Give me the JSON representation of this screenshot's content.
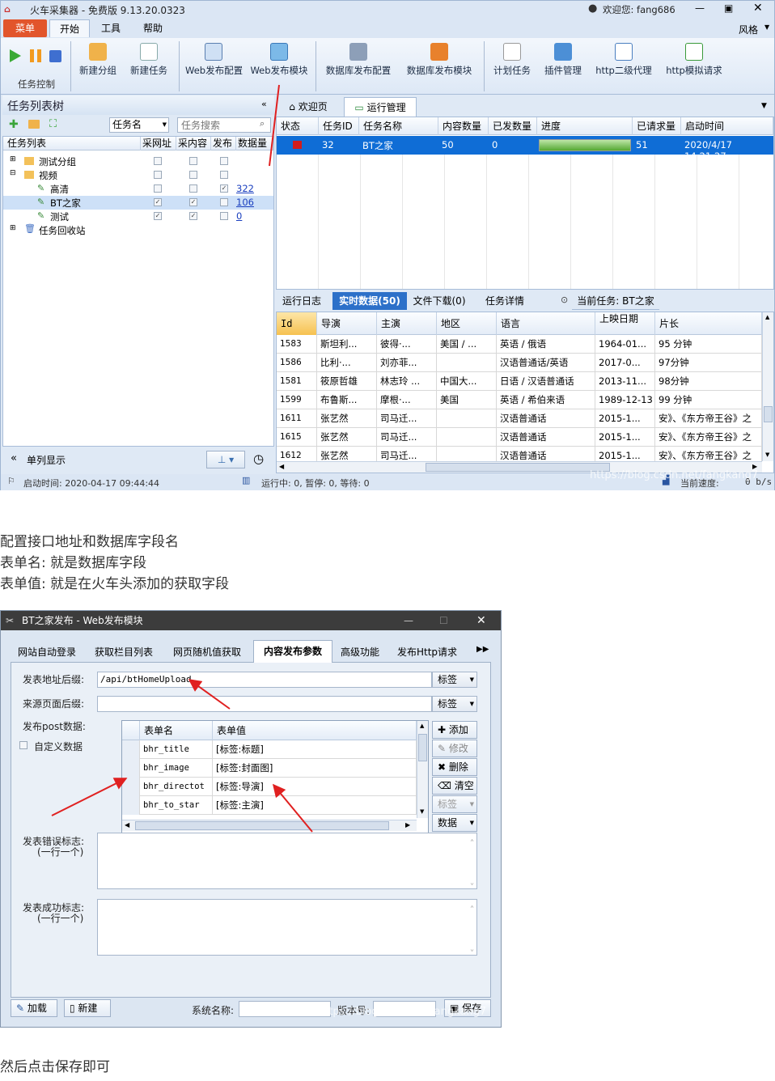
{
  "window": {
    "title": "火车采集器 - 免费版 9.13.20.0323",
    "welcome": "欢迎您: fang686",
    "style_label": "风格"
  },
  "menu": [
    "菜单",
    "开始",
    "工具",
    "帮助"
  ],
  "ribbon": {
    "group_label": "任务控制",
    "buttons": [
      "新建分组",
      "新建任务",
      "Web发布配置",
      "Web发布模块",
      "数据库发布配置",
      "数据库发布模块",
      "计划任务",
      "插件管理",
      "http二级代理",
      "http模拟请求"
    ]
  },
  "task_tree": {
    "title": "任务列表树",
    "filter_select": "任务名",
    "search_placeholder": "任务搜索",
    "columns": [
      "任务列表",
      "采网址",
      "采内容",
      "发布",
      "数据量"
    ],
    "nodes": [
      {
        "label": "测试分组",
        "level": 1
      },
      {
        "label": "视频",
        "level": 1
      },
      {
        "label": "高清",
        "level": 2,
        "count": "322"
      },
      {
        "label": "BT之家",
        "level": 2,
        "count": "106"
      },
      {
        "label": "测试",
        "level": 2,
        "count": "0"
      },
      {
        "label": "任务回收站",
        "level": 1
      }
    ],
    "single_col": "单列显示"
  },
  "doc_tabs": [
    "欢迎页",
    "运行管理"
  ],
  "run_grid": {
    "columns": [
      "状态",
      "任务ID",
      "任务名称",
      "内容数量",
      "已发数量",
      "进度",
      "已请求量",
      "启动时间"
    ],
    "row": {
      "id": "32",
      "name": "BT之家",
      "content": "50",
      "sent": "0",
      "progress": 1.0,
      "requested": "51",
      "start": "2020/4/17 14:21:27"
    }
  },
  "bottom_tabs": [
    "运行日志",
    "实时数据(50)",
    "文件下载(0)",
    "任务详情",
    "当前任务: BT之家"
  ],
  "data_grid": {
    "columns": [
      "Id",
      "导演",
      "主演",
      "地区",
      "语言",
      "上映日期",
      "片长"
    ],
    "rows": [
      [
        "1583",
        "斯坦利...",
        "彼得·...",
        "美国 / ...",
        "英语 / 俄语",
        "1964-01...",
        "95 分钟"
      ],
      [
        "1586",
        "比利·...",
        "刘亦菲...",
        "",
        "汉语普通话/英语",
        "2017-0...",
        "97分钟"
      ],
      [
        "1581",
        "筱原哲雄",
        "林志玲 ...",
        "中国大...",
        "日语 / 汉语普通话",
        "2013-11...",
        "98分钟"
      ],
      [
        "1599",
        "布鲁斯...",
        "摩根·...",
        "美国",
        "英语 / 希伯来语",
        "1989-12-13",
        "99 分钟"
      ],
      [
        "1611",
        "张艺然",
        "司马迁...",
        "",
        "汉语普通话",
        "2015-1...",
        "安》、《东方帝王谷》之"
      ],
      [
        "1615",
        "张艺然",
        "司马迁...",
        "",
        "汉语普通话",
        "2015-1...",
        "安》、《东方帝王谷》之"
      ],
      [
        "1612",
        "张艺然",
        "司马迁...",
        "",
        "汉语普通话",
        "2015-1...",
        "安》、《东方帝王谷》之"
      ]
    ]
  },
  "status": {
    "start_time": "启动时间: 2020-04-17 09:44:44",
    "running": "运行中: 0, 暂停: 0, 等待: 0",
    "speed": "当前速度:",
    "speed_val": "0 b/s",
    "watermark": "https://blog.csdn.net/fangkang7"
  },
  "prose": {
    "line1": "配置接口地址和数据库字段名",
    "line2": "表单名: 就是数据库字段",
    "line3": "表单值: 就是在火车头添加的获取字段",
    "line4": "然后点击保存即可"
  },
  "dialog": {
    "title": "BT之家发布 - Web发布模块",
    "tabs": [
      "网站自动登录",
      "获取栏目列表",
      "网页随机值获取",
      "内容发布参数",
      "高级功能",
      "发布Http请求"
    ],
    "post_suffix_label": "发表地址后缀:",
    "post_suffix_value": "/api/btHomeUpload",
    "referer_label": "来源页面后缀:",
    "referer_value": "",
    "tag_label": "标签",
    "post_data_label": "发布post数据:",
    "custom_data_label": "自定义数据",
    "form_columns": [
      "表单名",
      "表单值"
    ],
    "form_rows": [
      [
        "bhr_title",
        "[标签:标题]"
      ],
      [
        "bhr_image",
        "[标签:封面图]"
      ],
      [
        "bhr_directot",
        "[标签:导演]"
      ],
      [
        "bhr_to_star",
        "[标签:主演]"
      ]
    ],
    "side_buttons": [
      "添加",
      "修改",
      "删除",
      "清空",
      "标签",
      "数据"
    ],
    "error_label": "发表错误标志:",
    "error_hint": "(一行一个)",
    "success_label": "发表成功标志:",
    "success_hint": "(一行一个)",
    "load_button": "加载",
    "new_button": "新建",
    "system_name_label": "系统名称:",
    "version_label": "版本号:",
    "save_button": "保存",
    "watermark": "https://blog.csdn.net/fangkang7"
  }
}
